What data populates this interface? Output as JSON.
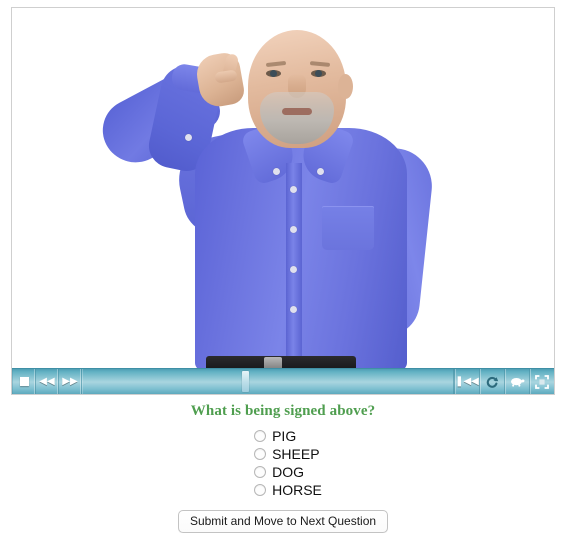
{
  "player": {
    "stage_description": "Video frame: bald man with gray beard wearing a blue button-down shirt, right hand raised to his temple performing an American Sign Language sign",
    "toolbar": {
      "stop_label": "Stop",
      "rewind_label": "Rewind",
      "fast_forward_label": "Fast Forward",
      "rewind_glyph": "◀◀",
      "fast_forward_glyph": "▶▶",
      "skip_to_start_glyph": "❚◀◀",
      "skip_to_start_label": "Skip to Start",
      "loop_glyph": "↻",
      "loop_label": "Loop",
      "slow_motion_label": "Slow Motion",
      "fullscreen_label": "Full Screen",
      "scrub_position_percent": 43,
      "track_color": "#8ec9d8",
      "toolbar_color": "#64b2c4"
    }
  },
  "quiz": {
    "question": "What is being signed above?",
    "question_color": "#4f9e4f",
    "options": [
      {
        "label": "PIG",
        "value": "pig",
        "selected": false
      },
      {
        "label": "SHEEP",
        "value": "sheep",
        "selected": false
      },
      {
        "label": "DOG",
        "value": "dog",
        "selected": false
      },
      {
        "label": "HORSE",
        "value": "horse",
        "selected": false
      }
    ],
    "submit_label": "Submit and Move to Next Question"
  }
}
